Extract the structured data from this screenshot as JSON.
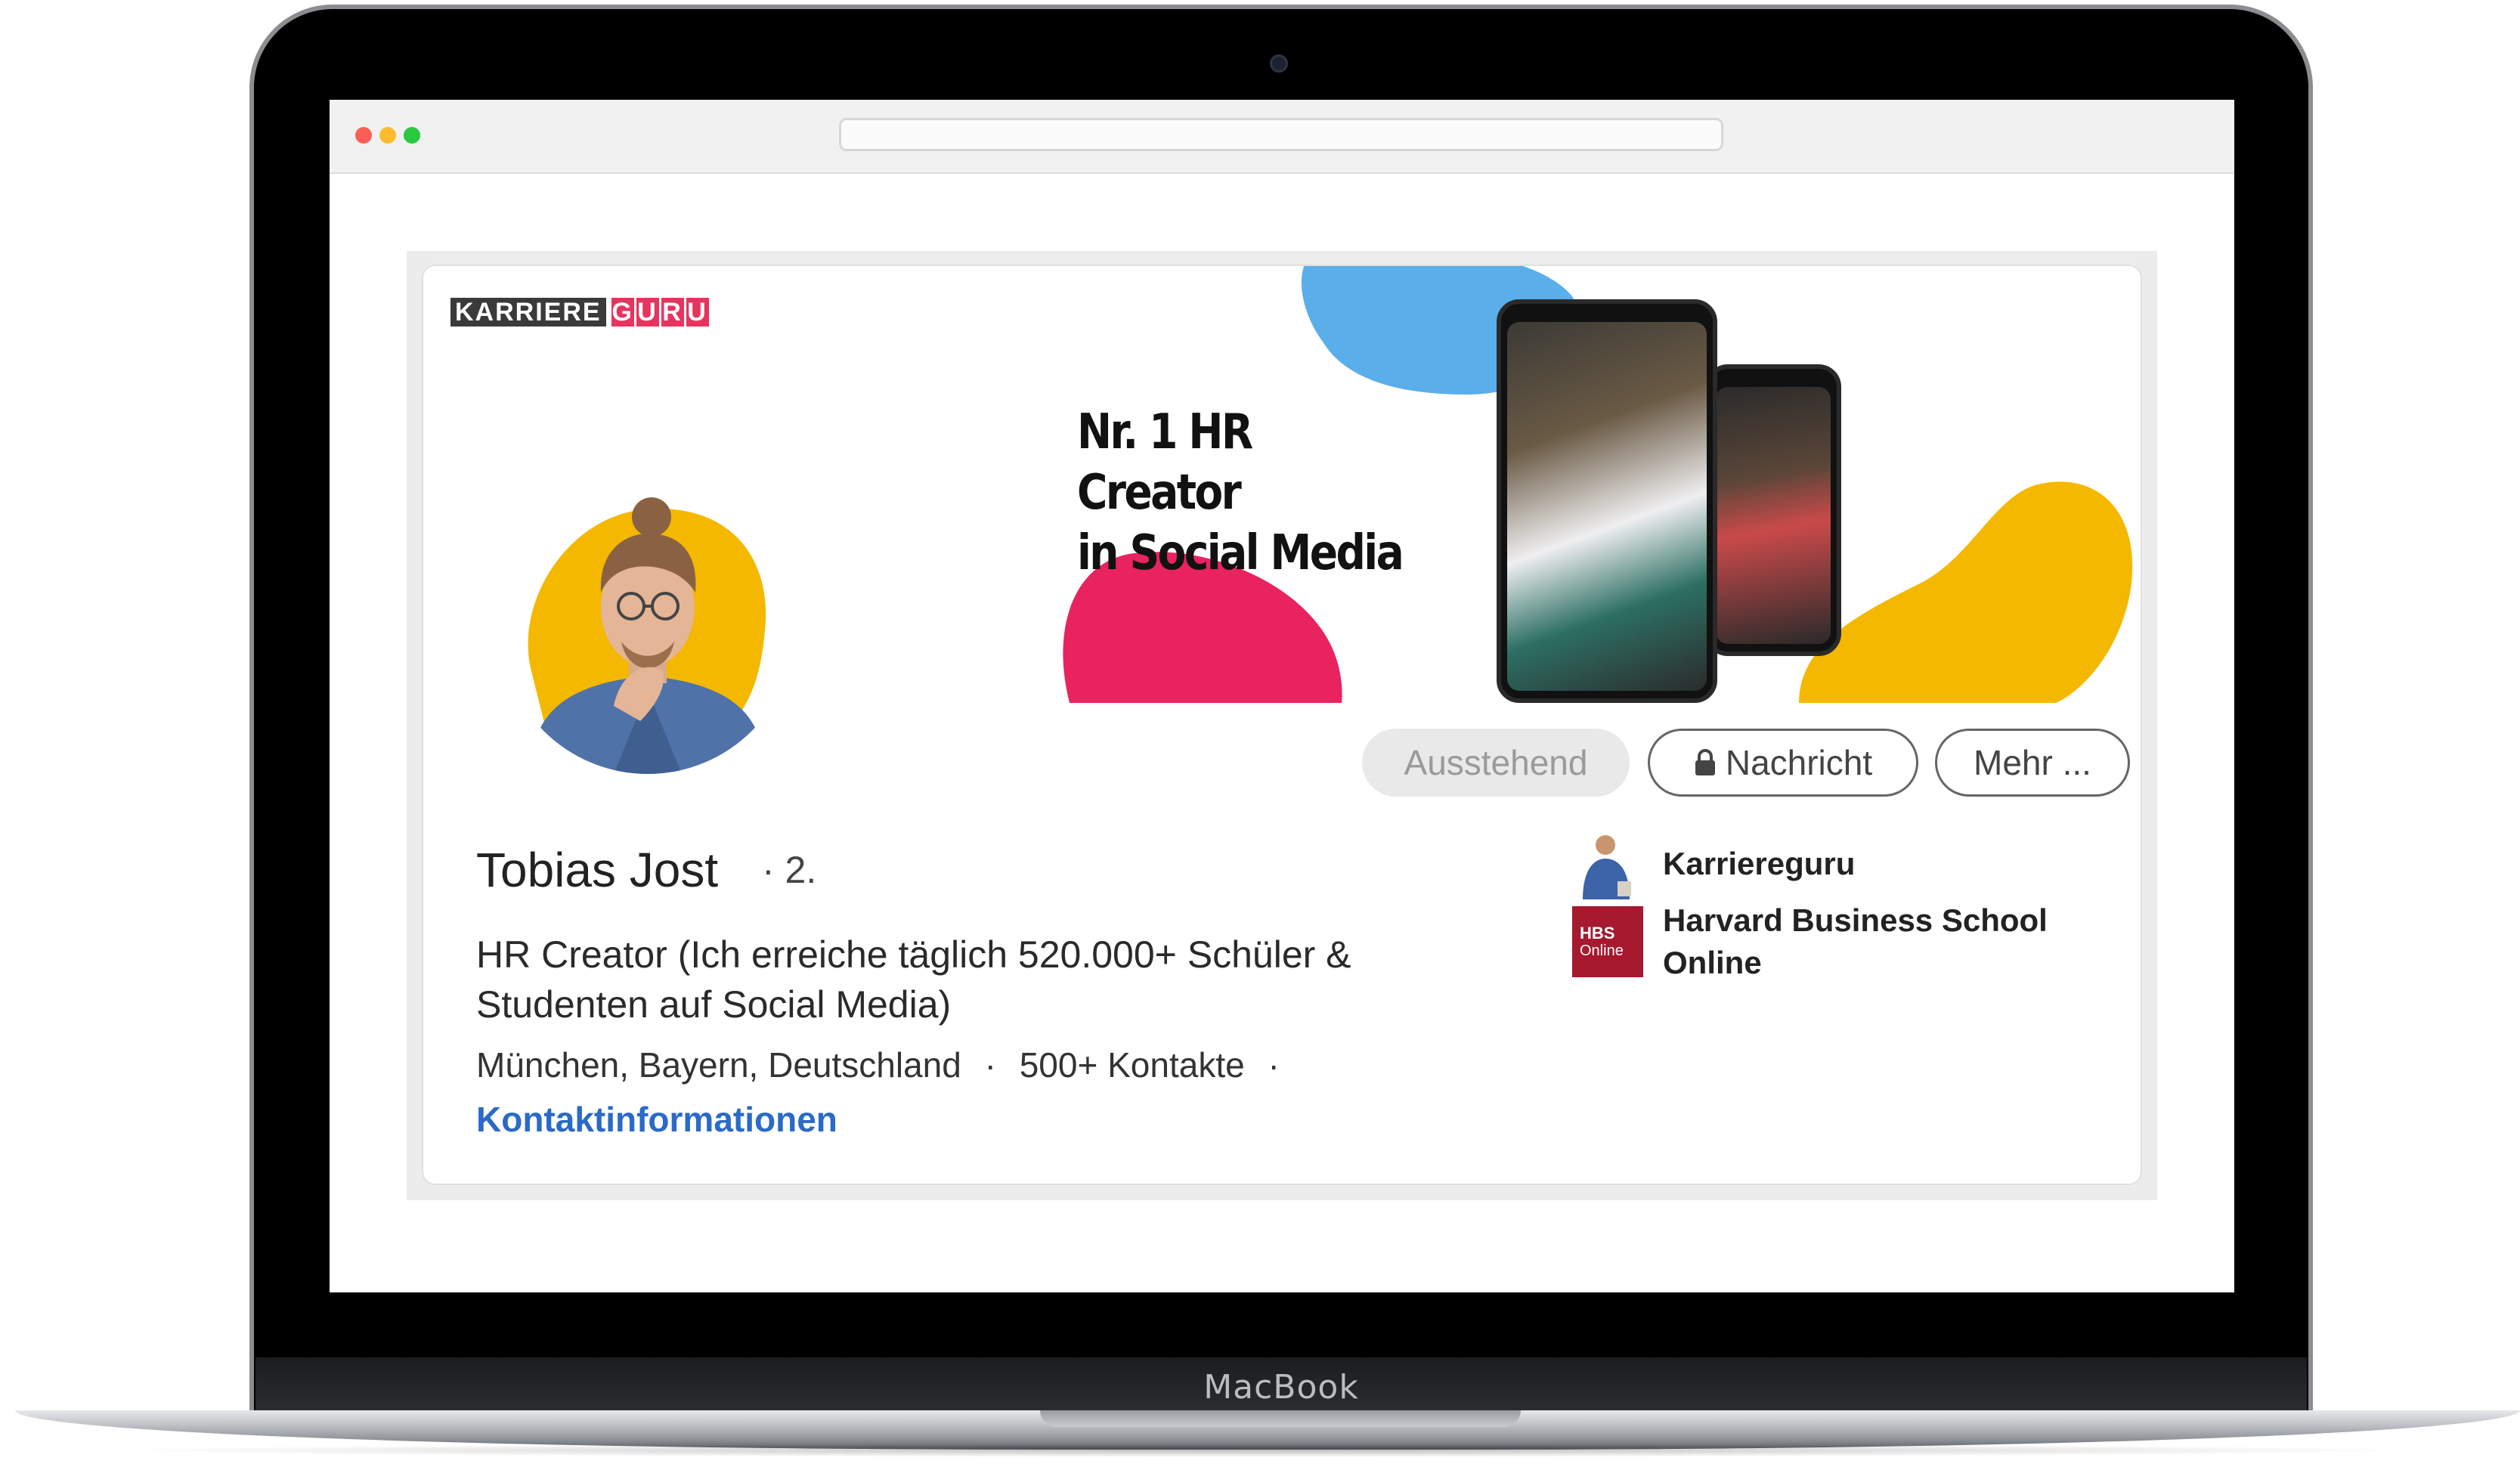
{
  "device": {
    "brand": "MacBook"
  },
  "banner": {
    "logo_left": "KARRIERE",
    "logo_right": [
      "G",
      "U",
      "R",
      "U"
    ],
    "tagline_line1": "Nr. 1 HR Creator",
    "tagline_line2": "in Social Media"
  },
  "actions": {
    "pending": "Ausstehend",
    "message": "Nachricht",
    "more": "Mehr ..."
  },
  "profile": {
    "name": "Tobias Jost",
    "degree": "· 2.",
    "headline": "HR Creator (Ich erreiche täglich 520.000+ Schüler & Studenten auf Social Media)",
    "location": "München, Bayern, Deutschland",
    "connections": "500+ Kontakte",
    "separator": "·",
    "contact_link": "Kontaktinformationen"
  },
  "affiliations": [
    {
      "name": "Karriereguru"
    },
    {
      "name": "Harvard Business School Online",
      "logo_line1": "HBS",
      "logo_line2": "Online"
    }
  ],
  "colors": {
    "blob_yellow": "#f5b800",
    "blob_pink": "#e8235f",
    "blob_blue": "#5aaeea",
    "link_blue": "#2a6ac8",
    "hbs_red": "#a6192e"
  }
}
